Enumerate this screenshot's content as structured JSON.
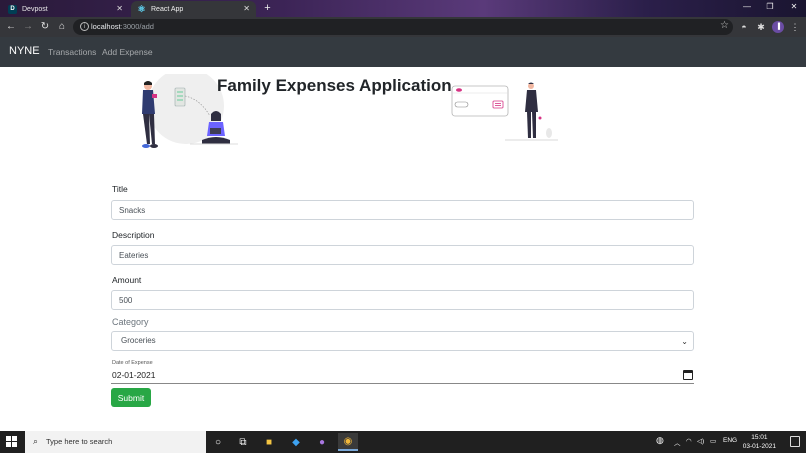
{
  "browser": {
    "tabs": [
      {
        "title": "Devpost",
        "favicon": "D"
      },
      {
        "title": "React App",
        "favicon": "⚛"
      }
    ],
    "url_host": "localhost",
    "url_path": ":3000/add"
  },
  "navbar": {
    "brand": "NYNE",
    "links": [
      "Transactions",
      "Add Expense"
    ]
  },
  "hero": {
    "title": "Family Expenses Application"
  },
  "form": {
    "title_label": "Title",
    "title_value": "Snacks",
    "description_label": "Description",
    "description_value": "Eateries",
    "amount_label": "Amount",
    "amount_value": "500",
    "category_label": "Category",
    "category_value": "Groceries",
    "date_label": "Date of Expense",
    "date_value": "02-01-2021",
    "submit_label": "Submit"
  },
  "taskbar": {
    "search_placeholder": "Type here to search",
    "language": "ENG",
    "time": "15:01",
    "date": "03-01-2021"
  },
  "colors": {
    "navbar_bg": "#343a40",
    "submit_bg": "#28a745",
    "illustration_accent": "#d63384"
  }
}
